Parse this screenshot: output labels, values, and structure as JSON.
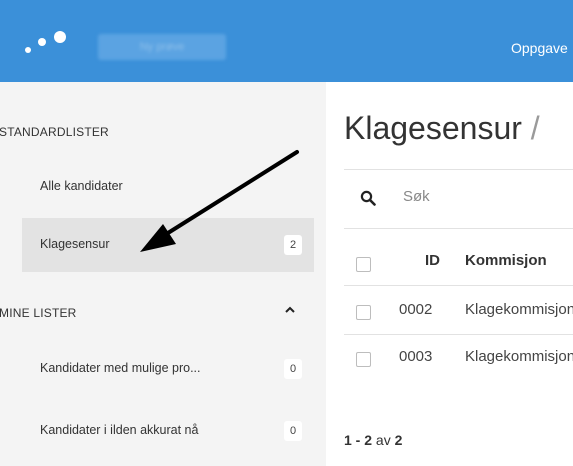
{
  "topbar": {
    "environment": "Ny prøve",
    "nav_item": "Oppgave"
  },
  "sidebar": {
    "standard_heading": "STANDARDLISTER",
    "standard_items": [
      {
        "label": "Alle kandidater",
        "count": ""
      },
      {
        "label": "Klagesensur",
        "count": "2"
      }
    ],
    "my_heading": "MINE LISTER",
    "my_items": [
      {
        "label": "Kandidater med mulige pro...",
        "count": "0"
      },
      {
        "label": "Kandidater i ilden akkurat nå",
        "count": "0"
      }
    ]
  },
  "main": {
    "title": "Klagesensur",
    "title_trail": "/",
    "search_placeholder": "Søk",
    "columns": {
      "id": "ID",
      "kommisjon": "Kommisjon"
    },
    "rows": [
      {
        "id": "0002",
        "kommisjon": "Klagekommisjon"
      },
      {
        "id": "0003",
        "kommisjon": "Klagekommisjon"
      }
    ],
    "pager": {
      "range": "1 - 2",
      "of": "av",
      "total": "2"
    }
  },
  "colors": {
    "topbar": "#3b90d9",
    "sidebar": "#f4f4f4",
    "active_item": "#e3e3e3"
  },
  "icons": [
    "app-logo-icon",
    "search-icon",
    "chevron-up-icon",
    "checkbox-icon",
    "arrow-annotation-icon"
  ]
}
